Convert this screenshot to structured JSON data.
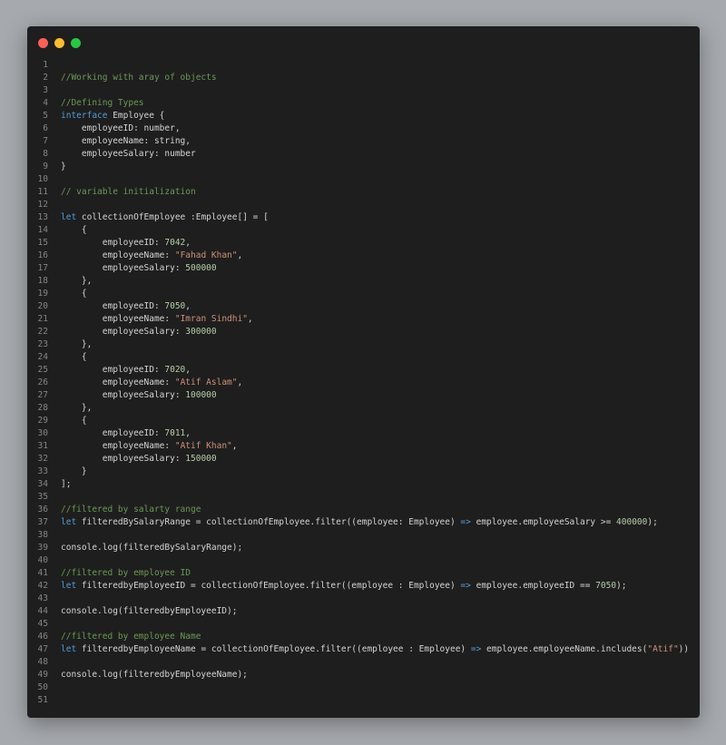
{
  "window": {
    "controls": [
      {
        "name": "close-button",
        "icon": "red-dot",
        "color": "#ff5f57"
      },
      {
        "name": "minimize-button",
        "icon": "yellow-dot",
        "color": "#febc2e"
      },
      {
        "name": "maximize-button",
        "icon": "green-dot",
        "color": "#28c840"
      }
    ]
  },
  "colors": {
    "background": "#1e1e1e",
    "comment": "#6a9955",
    "keyword": "#569cd6",
    "string": "#ce9178",
    "number": "#b5cea8",
    "text": "#d4d4d4",
    "line_number": "#858585"
  },
  "code": {
    "lines": [
      [],
      [
        [
          "c",
          "//Working with aray of objects"
        ]
      ],
      [],
      [
        [
          "c",
          "//Defining Types"
        ]
      ],
      [
        [
          "k",
          "interface"
        ],
        [
          "p",
          " Employee {"
        ]
      ],
      [
        [
          "p",
          "    employeeID: number,"
        ]
      ],
      [
        [
          "p",
          "    employeeName: string,"
        ]
      ],
      [
        [
          "p",
          "    employeeSalary: number"
        ]
      ],
      [
        [
          "p",
          "}"
        ]
      ],
      [],
      [
        [
          "c",
          "// variable initialization"
        ]
      ],
      [],
      [
        [
          "k",
          "let"
        ],
        [
          "p",
          " collectionOfEmployee :Employee[] = ["
        ]
      ],
      [
        [
          "p",
          "    {"
        ]
      ],
      [
        [
          "p",
          "        employeeID: "
        ],
        [
          "n",
          "7042"
        ],
        [
          "p",
          ","
        ]
      ],
      [
        [
          "p",
          "        employeeName: "
        ],
        [
          "s",
          "\"Fahad Khan\""
        ],
        [
          "p",
          ","
        ]
      ],
      [
        [
          "p",
          "        employeeSalary: "
        ],
        [
          "n",
          "500000"
        ]
      ],
      [
        [
          "p",
          "    },"
        ]
      ],
      [
        [
          "p",
          "    {"
        ]
      ],
      [
        [
          "p",
          "        employeeID: "
        ],
        [
          "n",
          "7050"
        ],
        [
          "p",
          ","
        ]
      ],
      [
        [
          "p",
          "        employeeName: "
        ],
        [
          "s",
          "\"Imran Sindhi\""
        ],
        [
          "p",
          ","
        ]
      ],
      [
        [
          "p",
          "        employeeSalary: "
        ],
        [
          "n",
          "300000"
        ]
      ],
      [
        [
          "p",
          "    },"
        ]
      ],
      [
        [
          "p",
          "    {"
        ]
      ],
      [
        [
          "p",
          "        employeeID: "
        ],
        [
          "n",
          "7020"
        ],
        [
          "p",
          ","
        ]
      ],
      [
        [
          "p",
          "        employeeName: "
        ],
        [
          "s",
          "\"Atif Aslam\""
        ],
        [
          "p",
          ","
        ]
      ],
      [
        [
          "p",
          "        employeeSalary: "
        ],
        [
          "n",
          "100000"
        ]
      ],
      [
        [
          "p",
          "    },"
        ]
      ],
      [
        [
          "p",
          "    {"
        ]
      ],
      [
        [
          "p",
          "        employeeID: "
        ],
        [
          "n",
          "7011"
        ],
        [
          "p",
          ","
        ]
      ],
      [
        [
          "p",
          "        employeeName: "
        ],
        [
          "s",
          "\"Atif Khan\""
        ],
        [
          "p",
          ","
        ]
      ],
      [
        [
          "p",
          "        employeeSalary: "
        ],
        [
          "n",
          "150000"
        ]
      ],
      [
        [
          "p",
          "    }"
        ]
      ],
      [
        [
          "p",
          "];"
        ]
      ],
      [],
      [
        [
          "c",
          "//filtered by salarty range"
        ]
      ],
      [
        [
          "k",
          "let"
        ],
        [
          "p",
          " filteredBySalaryRange = collectionOfEmployee.filter((employee: Employee) "
        ],
        [
          "k",
          "=>"
        ],
        [
          "p",
          " employee.employeeSalary >= "
        ],
        [
          "n",
          "400000"
        ],
        [
          "p",
          ");"
        ]
      ],
      [],
      [
        [
          "p",
          "console.log(filteredBySalaryRange);"
        ]
      ],
      [],
      [
        [
          "c",
          "//filtered by employee ID"
        ]
      ],
      [
        [
          "k",
          "let"
        ],
        [
          "p",
          " filteredbyEmployeeID = collectionOfEmployee.filter((employee : Employee) "
        ],
        [
          "k",
          "=>"
        ],
        [
          "p",
          " employee.employeeID == "
        ],
        [
          "n",
          "7050"
        ],
        [
          "p",
          ");"
        ]
      ],
      [],
      [
        [
          "p",
          "console.log(filteredbyEmployeeID);"
        ]
      ],
      [],
      [
        [
          "c",
          "//filtered by employee Name"
        ]
      ],
      [
        [
          "k",
          "let"
        ],
        [
          "p",
          " filteredbyEmployeeName = collectionOfEmployee.filter((employee : Employee) "
        ],
        [
          "k",
          "=>"
        ],
        [
          "p",
          " employee.employeeName.includes("
        ],
        [
          "s",
          "\"Atif\""
        ],
        [
          "p",
          "))"
        ]
      ],
      [],
      [
        [
          "p",
          "console.log(filteredbyEmployeeName);"
        ]
      ],
      [],
      []
    ]
  }
}
